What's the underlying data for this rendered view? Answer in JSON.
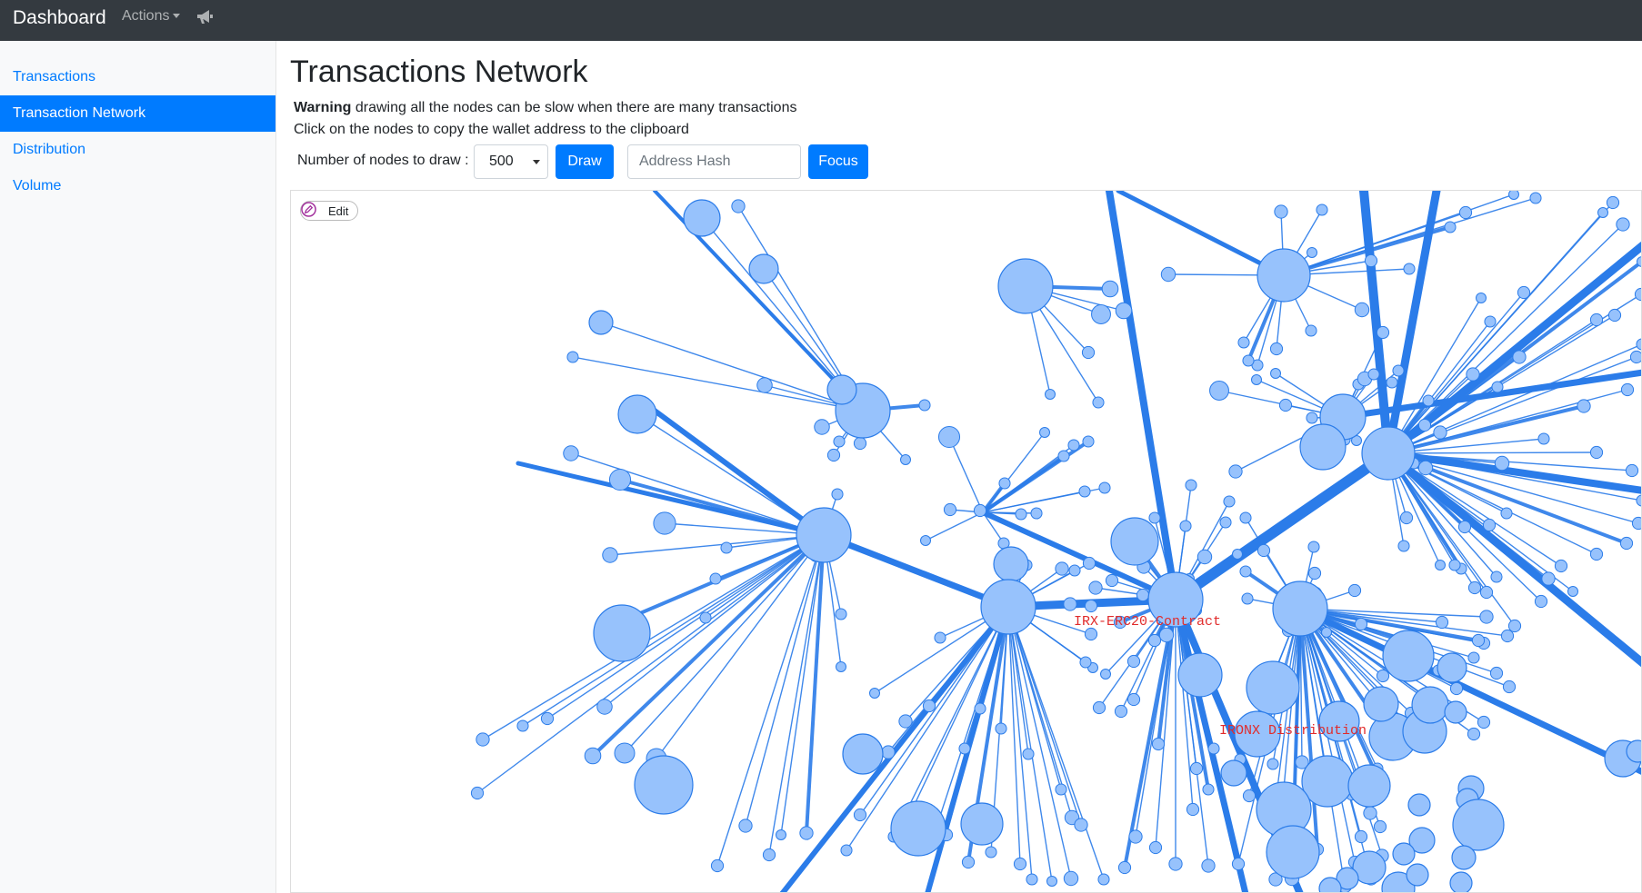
{
  "nav": {
    "brand": "Dashboard",
    "actions_label": "Actions",
    "icons": [
      "caret-down-icon",
      "megaphone-icon"
    ]
  },
  "sidebar": {
    "items": [
      {
        "label": "Transactions",
        "active": false
      },
      {
        "label": "Transaction Network",
        "active": true
      },
      {
        "label": "Distribution",
        "active": false
      },
      {
        "label": "Volume",
        "active": false
      }
    ]
  },
  "main": {
    "title": "Transactions Network",
    "warning_strong": "Warning",
    "warning_text": " drawing all the nodes can be slow when there are many transactions",
    "hint": "Click on the nodes to copy the wallet address to the clipboard",
    "nodes_label": "Number of nodes to draw :",
    "nodes_value": "500",
    "draw_label": "Draw",
    "address_placeholder": "Address Hash",
    "focus_label": "Focus"
  },
  "graph": {
    "edit_label": "Edit",
    "labels": {
      "contract": "IRX-ERC20-Contract",
      "distribution": "IRONX Distribution"
    }
  },
  "colors": {
    "navbar": "#343a40",
    "primary": "#007bff",
    "node_fill": "#97c2fc",
    "edge": "#2b7ce9",
    "highlight_label": "#e12b2b"
  }
}
